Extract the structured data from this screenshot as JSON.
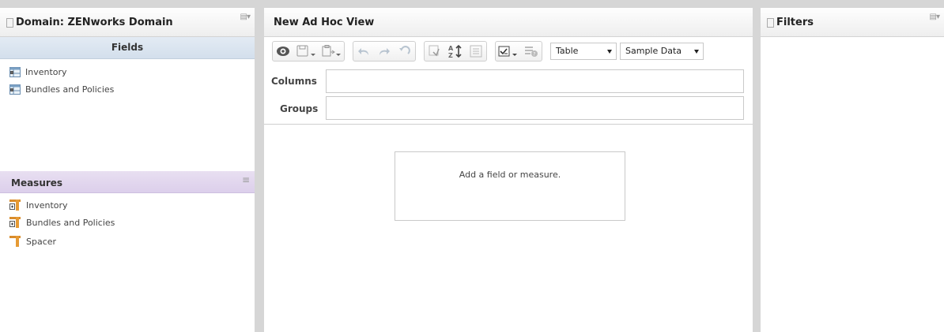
{
  "left_panel": {
    "title": "Domain: ZENworks Domain",
    "fields_header": "Fields",
    "fields": [
      "Inventory",
      "Bundles and Policies"
    ],
    "measures_header": "Measures",
    "measures": [
      "Inventory",
      "Bundles and Policies",
      "Spacer"
    ]
  },
  "center_panel": {
    "title": "New Ad Hoc View",
    "toolbar": {
      "icons": [
        "eye-icon",
        "save-icon",
        "export-icon",
        "undo-icon",
        "redo-icon",
        "undo-all-icon",
        "switch-axes-icon",
        "sort-icon",
        "hide-details-icon",
        "display-options-icon",
        "query-info-icon"
      ],
      "view_type": "Table",
      "data_mode": "Sample Data"
    },
    "columns_label": "Columns",
    "groups_label": "Groups",
    "empty_message": "Add a field or measure."
  },
  "right_panel": {
    "title": "Filters"
  }
}
